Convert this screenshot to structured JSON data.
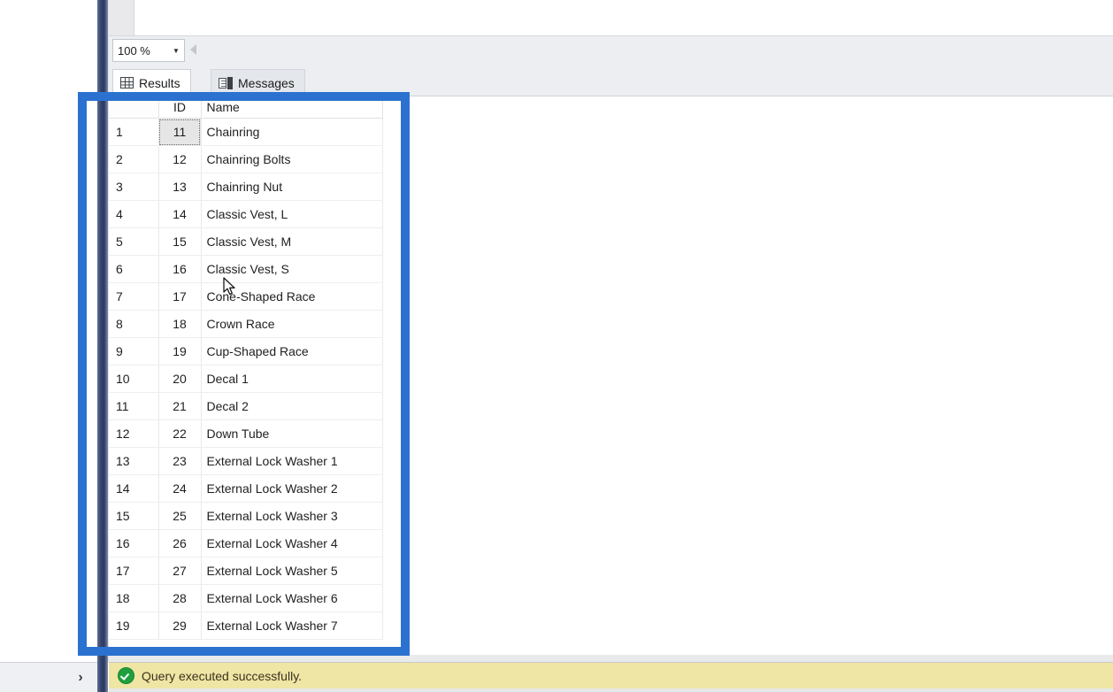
{
  "window": {
    "app": "SQL Server Management Studio",
    "pane": "results-pane"
  },
  "zoom_bar": {
    "zoom_value": "100 %",
    "dropdown_icon": "chevron-down-icon",
    "prev_icon": "triangle-left-icon"
  },
  "tabs": [
    {
      "label": "Results",
      "icon": "grid-icon",
      "active": true
    },
    {
      "label": "Messages",
      "icon": "message-document-icon",
      "active": false
    }
  ],
  "grid": {
    "columns": [
      "",
      "ID",
      "Name"
    ],
    "focused_row_index": 0,
    "rows": [
      {
        "num": "1",
        "id": "11",
        "name": "Chainring"
      },
      {
        "num": "2",
        "id": "12",
        "name": "Chainring Bolts"
      },
      {
        "num": "3",
        "id": "13",
        "name": "Chainring Nut"
      },
      {
        "num": "4",
        "id": "14",
        "name": "Classic Vest, L"
      },
      {
        "num": "5",
        "id": "15",
        "name": "Classic Vest, M"
      },
      {
        "num": "6",
        "id": "16",
        "name": "Classic Vest, S"
      },
      {
        "num": "7",
        "id": "17",
        "name": "Cone-Shaped Race"
      },
      {
        "num": "8",
        "id": "18",
        "name": "Crown Race"
      },
      {
        "num": "9",
        "id": "19",
        "name": "Cup-Shaped Race"
      },
      {
        "num": "10",
        "id": "20",
        "name": "Decal 1"
      },
      {
        "num": "11",
        "id": "21",
        "name": "Decal 2"
      },
      {
        "num": "12",
        "id": "22",
        "name": "Down Tube"
      },
      {
        "num": "13",
        "id": "23",
        "name": "External Lock Washer 1"
      },
      {
        "num": "14",
        "id": "24",
        "name": "External Lock Washer 2"
      },
      {
        "num": "15",
        "id": "25",
        "name": "External Lock Washer 3"
      },
      {
        "num": "16",
        "id": "26",
        "name": "External Lock Washer 4"
      },
      {
        "num": "17",
        "id": "27",
        "name": "External Lock Washer 5"
      },
      {
        "num": "18",
        "id": "28",
        "name": "External Lock Washer 6"
      },
      {
        "num": "19",
        "id": "29",
        "name": "External Lock Washer 7"
      }
    ]
  },
  "status": {
    "icon": "success-check-icon",
    "message": "Query executed successfully."
  },
  "bottom_left": {
    "expand_label": "›",
    "icon": "chevron-right-icon"
  },
  "annotation": {
    "shape": "rectangle-highlight",
    "color": "#2b72d0"
  },
  "colors": {
    "annotation": "#2b72d0",
    "status_bg": "#efe5a4",
    "success": "#1f9f3e",
    "panel_strip": "#2b3a61"
  }
}
